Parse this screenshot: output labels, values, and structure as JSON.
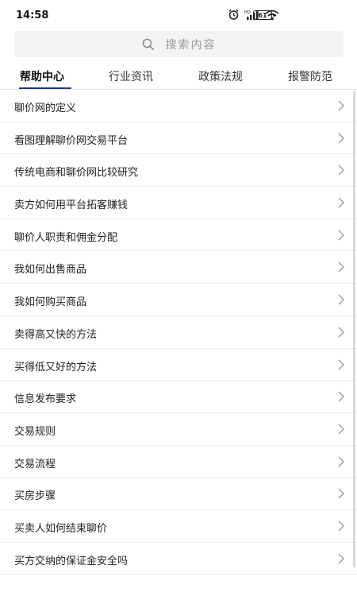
{
  "status": {
    "time": "14:58",
    "battery": "61"
  },
  "search": {
    "placeholder": "搜索内容"
  },
  "tabs": [
    {
      "label": "帮助中心"
    },
    {
      "label": "行业资讯"
    },
    {
      "label": "政策法规"
    },
    {
      "label": "报警防范"
    }
  ],
  "list": [
    "聊价网的定义",
    "看图理解聊价网交易平台",
    "传统电商和聊价网比较研究",
    "卖方如何用平台拓客赚钱",
    "聊价人职责和佣金分配",
    "我如何出售商品",
    "我如何购买商品",
    "卖得高又快的方法",
    "买得低又好的方法",
    "信息发布要求",
    "交易规则",
    "交易流程",
    "买房步骤",
    "买卖人如何结束聊价",
    "买方交纳的保证金安全吗"
  ]
}
